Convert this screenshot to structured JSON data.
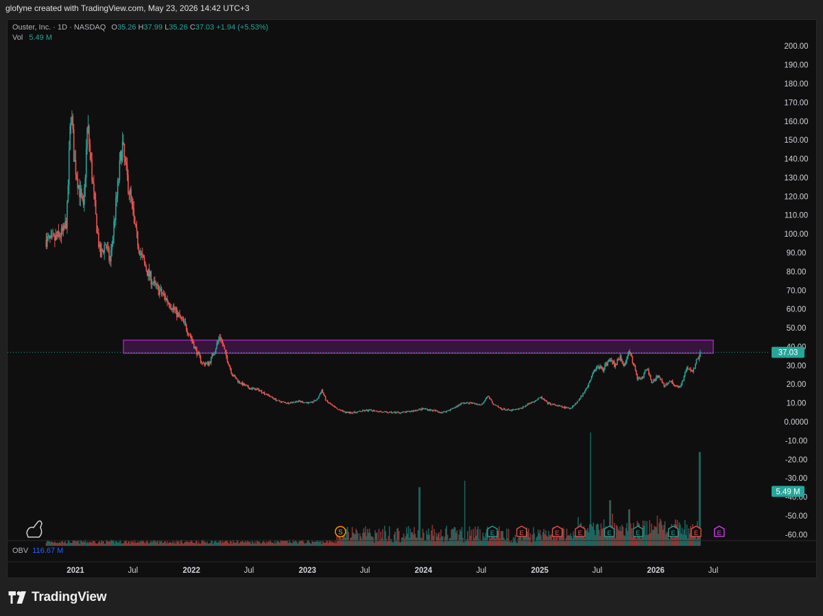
{
  "header": {
    "text": "glofyne created with TradingView.com, May 23, 2026 14:42 UTC+3"
  },
  "legend": {
    "symbol": "Ouster, Inc. · 1D · NASDAQ",
    "o_label": "O",
    "o": "35.26",
    "h_label": "H",
    "h": "37.99",
    "l_label": "L",
    "l": "35.26",
    "c_label": "C",
    "c": "37.03",
    "change": "+1.94 (+5.53%)",
    "vol_label": "Vol",
    "vol": "5.49 M"
  },
  "obv": {
    "label": "OBV",
    "value": "116.67 M"
  },
  "brand": {
    "name": "TradingView"
  },
  "colors": {
    "up": "#26a69a",
    "down": "#ef5350",
    "zone": "#9c27b0",
    "obv": "#2962ff",
    "background": "#0f0f0f"
  },
  "chart_data": {
    "type": "candlestick",
    "symbol": "Ouster, Inc.",
    "interval": "1D",
    "exchange": "NASDAQ",
    "y_axis": {
      "ticks": [
        "200.00",
        "190.00",
        "180.00",
        "170.00",
        "160.00",
        "150.00",
        "140.00",
        "130.00",
        "120.00",
        "110.00",
        "100.00",
        "90.00",
        "80.00",
        "70.00",
        "60.00",
        "50.00",
        "40.00",
        "30.00",
        "20.00",
        "10.00",
        "0.0000",
        "-10.00",
        "-20.00",
        "-30.00",
        "-40.00",
        "-50.00",
        "-60.00"
      ],
      "range": [
        -67,
        205
      ],
      "gridlines": false
    },
    "x_axis": {
      "ticks": [
        "2021",
        "Jul",
        "2022",
        "Jul",
        "2023",
        "Jul",
        "2024",
        "Jul",
        "2025",
        "Jul",
        "2026",
        "Jul"
      ],
      "tick_dates": [
        "2021-01-01",
        "2021-07-01",
        "2022-01-01",
        "2022-07-01",
        "2023-01-01",
        "2023-07-01",
        "2024-01-01",
        "2024-07-01",
        "2025-01-01",
        "2025-07-01",
        "2026-01-01",
        "2026-07-01"
      ]
    },
    "price_path": [
      [
        "2020-10-01",
        97
      ],
      [
        "2020-10-20",
        96
      ],
      [
        "2020-11-10",
        99
      ],
      [
        "2020-11-25",
        101
      ],
      [
        "2020-12-05",
        108
      ],
      [
        "2020-12-18",
        168
      ],
      [
        "2020-12-28",
        140
      ],
      [
        "2021-01-12",
        125
      ],
      [
        "2021-01-26",
        112
      ],
      [
        "2021-02-08",
        158
      ],
      [
        "2021-02-20",
        135
      ],
      [
        "2021-03-05",
        110
      ],
      [
        "2021-03-20",
        88
      ],
      [
        "2021-04-05",
        95
      ],
      [
        "2021-04-20",
        85
      ],
      [
        "2021-05-08",
        115
      ],
      [
        "2021-05-28",
        148
      ],
      [
        "2021-06-10",
        132
      ],
      [
        "2021-06-25",
        118
      ],
      [
        "2021-07-10",
        100
      ],
      [
        "2021-07-28",
        88
      ],
      [
        "2021-08-15",
        80
      ],
      [
        "2021-09-05",
        73
      ],
      [
        "2021-10-01",
        68
      ],
      [
        "2021-10-25",
        63
      ],
      [
        "2021-11-15",
        58
      ],
      [
        "2021-12-10",
        52
      ],
      [
        "2021-12-28",
        46
      ],
      [
        "2022-01-15",
        38
      ],
      [
        "2022-02-05",
        31
      ],
      [
        "2022-02-25",
        31
      ],
      [
        "2022-03-15",
        38
      ],
      [
        "2022-04-01",
        46
      ],
      [
        "2022-04-18",
        36
      ],
      [
        "2022-05-10",
        25
      ],
      [
        "2022-06-01",
        21
      ],
      [
        "2022-07-01",
        18
      ],
      [
        "2022-08-01",
        17
      ],
      [
        "2022-09-01",
        14
      ],
      [
        "2022-10-01",
        11
      ],
      [
        "2022-11-01",
        10
      ],
      [
        "2022-12-01",
        11
      ],
      [
        "2023-01-10",
        10
      ],
      [
        "2023-02-01",
        12
      ],
      [
        "2023-02-15",
        17
      ],
      [
        "2023-03-01",
        11
      ],
      [
        "2023-04-01",
        7
      ],
      [
        "2023-05-01",
        5
      ],
      [
        "2023-06-01",
        5
      ],
      [
        "2023-07-01",
        6
      ],
      [
        "2023-08-01",
        6
      ],
      [
        "2023-09-01",
        5
      ],
      [
        "2023-10-01",
        5
      ],
      [
        "2023-11-01",
        5
      ],
      [
        "2023-12-01",
        6
      ],
      [
        "2024-01-01",
        7
      ],
      [
        "2024-02-01",
        6
      ],
      [
        "2024-03-01",
        5
      ],
      [
        "2024-04-01",
        7
      ],
      [
        "2024-05-01",
        10
      ],
      [
        "2024-06-01",
        10
      ],
      [
        "2024-07-01",
        9
      ],
      [
        "2024-07-20",
        14
      ],
      [
        "2024-08-10",
        9
      ],
      [
        "2024-09-01",
        7
      ],
      [
        "2024-10-01",
        6
      ],
      [
        "2024-11-01",
        7
      ],
      [
        "2024-12-01",
        10
      ],
      [
        "2025-01-05",
        13
      ],
      [
        "2025-01-25",
        10
      ],
      [
        "2025-02-15",
        9
      ],
      [
        "2025-03-10",
        8
      ],
      [
        "2025-04-05",
        7
      ],
      [
        "2025-05-01",
        11
      ],
      [
        "2025-05-25",
        17
      ],
      [
        "2025-06-15",
        25
      ],
      [
        "2025-07-01",
        30
      ],
      [
        "2025-07-20",
        28
      ],
      [
        "2025-08-10",
        34
      ],
      [
        "2025-08-25",
        30
      ],
      [
        "2025-09-10",
        35
      ],
      [
        "2025-09-25",
        29
      ],
      [
        "2025-10-08",
        39
      ],
      [
        "2025-10-20",
        32
      ],
      [
        "2025-11-05",
        23
      ],
      [
        "2025-11-20",
        24
      ],
      [
        "2025-12-05",
        28
      ],
      [
        "2025-12-20",
        21
      ],
      [
        "2026-01-10",
        25
      ],
      [
        "2026-01-28",
        19
      ],
      [
        "2026-02-15",
        22
      ],
      [
        "2026-03-01",
        20
      ],
      [
        "2026-03-15",
        18
      ],
      [
        "2026-03-28",
        23
      ],
      [
        "2026-04-10",
        29
      ],
      [
        "2026-04-25",
        26
      ],
      [
        "2026-05-10",
        33
      ],
      [
        "2026-05-22",
        37.03
      ]
    ],
    "last_price": 37.03,
    "last_price_label": "37.03",
    "resistance_zone": {
      "from_date": "2021-06-01",
      "to_date": "2026-07-01",
      "y_low": 36.5,
      "y_high": 43.5
    },
    "volume": {
      "label": "5.49 M",
      "highlights": [
        [
          "2023-12-20",
          0.45
        ],
        [
          "2024-05-10",
          0.5
        ],
        [
          "2025-06-10",
          0.87
        ],
        [
          "2026-05-20",
          0.72
        ],
        [
          "2025-08-10",
          0.35
        ],
        [
          "2025-10-10",
          0.28
        ]
      ]
    },
    "event_markers": [
      {
        "date": "2023-04-15",
        "type": "S",
        "kind": "split"
      },
      {
        "date": "2024-08-05",
        "type": "E",
        "kind": "earnings-up"
      },
      {
        "date": "2024-11-05",
        "type": "E",
        "kind": "earnings-down"
      },
      {
        "date": "2025-02-25",
        "type": "E",
        "kind": "earnings-down"
      },
      {
        "date": "2025-05-08",
        "type": "E",
        "kind": "earnings-down"
      },
      {
        "date": "2025-08-08",
        "type": "E",
        "kind": "earnings-up"
      },
      {
        "date": "2025-11-06",
        "type": "E",
        "kind": "earnings-up"
      },
      {
        "date": "2026-02-25",
        "type": "E",
        "kind": "earnings-up"
      },
      {
        "date": "2026-05-08",
        "type": "E",
        "kind": "earnings-down"
      },
      {
        "date": "2026-07-20",
        "type": "E",
        "kind": "earnings-upcoming"
      }
    ]
  }
}
